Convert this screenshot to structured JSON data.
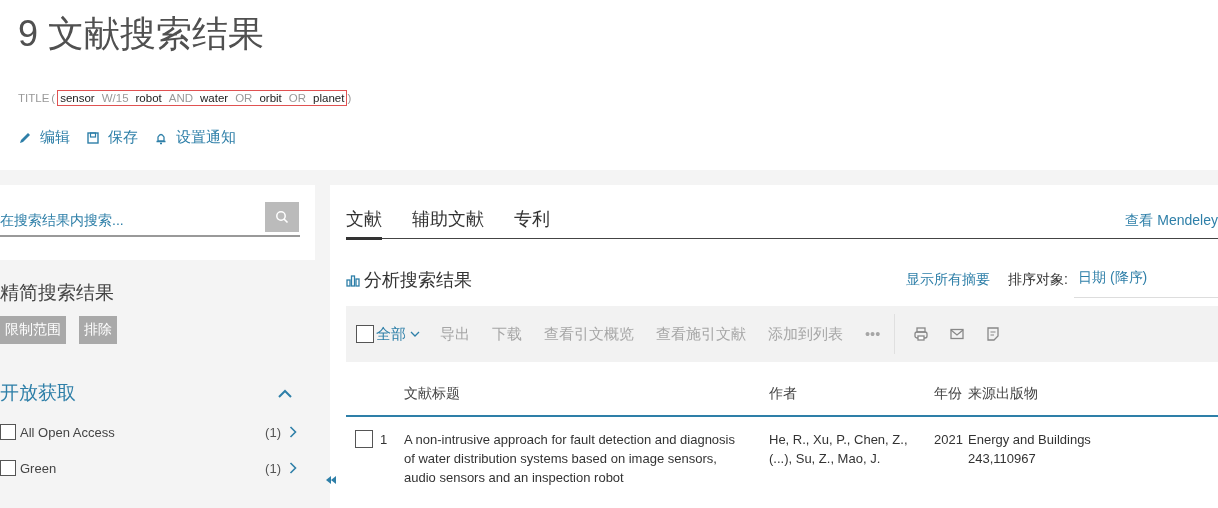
{
  "heading": "9 文献搜索结果",
  "query": {
    "field": "TITLE",
    "open": "(",
    "close": ")",
    "terms": [
      {
        "kind": "term",
        "text": "sensor"
      },
      {
        "kind": "operator",
        "text": "W/15"
      },
      {
        "kind": "term",
        "text": "robot"
      },
      {
        "kind": "operator",
        "text": "AND"
      },
      {
        "kind": "term",
        "text": "water"
      },
      {
        "kind": "operator",
        "text": "OR"
      },
      {
        "kind": "term",
        "text": "orbit"
      },
      {
        "kind": "operator",
        "text": "OR"
      },
      {
        "kind": "term",
        "text": "planet"
      }
    ]
  },
  "actions": [
    {
      "kind": "edit",
      "label": "编辑"
    },
    {
      "kind": "save",
      "label": "保存"
    },
    {
      "kind": "alert",
      "label": "设置通知"
    }
  ],
  "sidebar": {
    "search": {
      "placeholder": "在搜索结果内搜索..."
    },
    "refine_title": "精简搜索结果",
    "refine_buttons": [
      {
        "label": "限制范围",
        "disabled": true
      },
      {
        "label": "排除",
        "disabled": true
      }
    ],
    "facet": {
      "title": "开放获取",
      "expanded": true,
      "items": [
        {
          "label": "All Open Access",
          "count": "(1)",
          "checked": false
        },
        {
          "label": "Green",
          "count": "(1)",
          "checked": false
        }
      ]
    }
  },
  "tabs": [
    {
      "label": "文献",
      "selected": true
    },
    {
      "label": "辅助文献",
      "selected": false
    },
    {
      "label": "专利",
      "selected": false
    }
  ],
  "mendeley_link": "查看 Mendeley",
  "analyze": "分析搜索结果",
  "show_abstracts": "显示所有摘要",
  "sort": {
    "label": "排序对象:",
    "value": "日期 (降序)"
  },
  "toolbar": {
    "select_all": {
      "label": "全部",
      "checked": false
    },
    "items": [
      {
        "label": "导出",
        "disabled": true
      },
      {
        "label": "下载",
        "disabled": true
      },
      {
        "label": "查看引文概览",
        "disabled": true
      },
      {
        "label": "查看施引文献",
        "disabled": true
      },
      {
        "label": "添加到列表",
        "disabled": true
      },
      {
        "label": "•••",
        "disabled": true
      }
    ]
  },
  "table": {
    "columns": [
      "文献标题",
      "作者",
      "年份",
      "来源出版物"
    ],
    "rows": [
      {
        "checked": false,
        "number": "1",
        "title": "A non-intrusive approach for fault detection and diagnosis of water distribution systems based on image sensors, audio sensors and an inspection robot",
        "authors": "He, R., Xu, P., Chen, Z., (...), Su, Z., Mao, J.",
        "year": "2021",
        "source": "Energy and Buildings 243,110967"
      }
    ]
  }
}
